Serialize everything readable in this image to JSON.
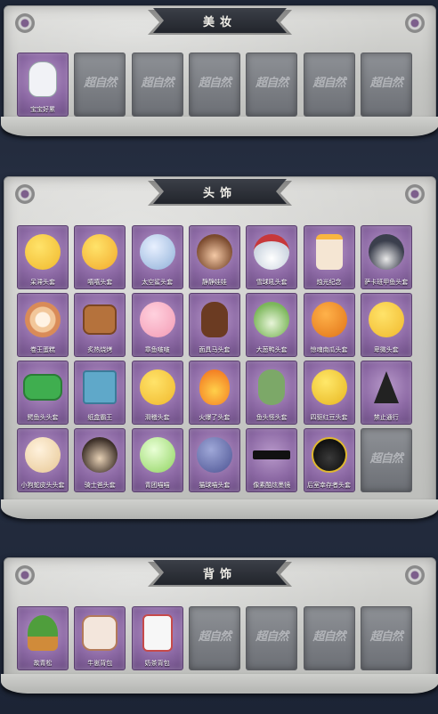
{
  "empty_slot_text": "超自然",
  "sections": [
    {
      "title": "美妆",
      "items": [
        {
          "name": "宝宝好累",
          "icon": "tired-baby-icon",
          "filled": true
        },
        {
          "filled": false
        },
        {
          "filled": false
        },
        {
          "filled": false
        },
        {
          "filled": false
        },
        {
          "filled": false
        },
        {
          "filled": false
        }
      ]
    },
    {
      "title": "头饰",
      "items": [
        {
          "name": "呆滞头套",
          "icon": "dazed-emoji-head-icon",
          "filled": true
        },
        {
          "name": "嘻嘻头套",
          "icon": "grinning-emoji-head-icon",
          "filled": true
        },
        {
          "name": "太空鲨头套",
          "icon": "space-shark-head-icon",
          "filled": true
        },
        {
          "name": "静静娃娃",
          "icon": "doll-head-icon",
          "filled": true
        },
        {
          "name": "雪球吼头套",
          "icon": "snowman-head-icon",
          "filled": true
        },
        {
          "name": "烛光纪念",
          "icon": "candle-head-icon",
          "filled": true
        },
        {
          "name": "萨卡班甲鱼头套",
          "icon": "fish-head-icon",
          "filled": true
        },
        {
          "name": "卷王蛋糕",
          "icon": "cake-roll-head-icon",
          "filled": true
        },
        {
          "name": "炙热烧烤",
          "icon": "bbq-head-icon",
          "filled": true
        },
        {
          "name": "章鱼啵啵",
          "icon": "octopus-head-icon",
          "filled": true
        },
        {
          "name": "面具马头套",
          "icon": "horse-head-icon",
          "filled": true
        },
        {
          "name": "大葱鸭头套",
          "icon": "scallion-duck-head-icon",
          "filled": true
        },
        {
          "name": "惊魂南瓜头套",
          "icon": "pumpkin-head-icon",
          "filled": true
        },
        {
          "name": "卑微头套",
          "icon": "humble-emoji-head-icon",
          "filled": true
        },
        {
          "name": "鳄鱼头头套",
          "icon": "crocodile-head-icon",
          "filled": true
        },
        {
          "name": "纸盒霸王",
          "icon": "box-monster-head-icon",
          "filled": true
        },
        {
          "name": "滑稽头套",
          "icon": "funny-emoji-head-icon",
          "filled": true
        },
        {
          "name": "火爆了头套",
          "icon": "fire-head-icon",
          "filled": true
        },
        {
          "name": "鱼头怪头套",
          "icon": "fish-monster-head-icon",
          "filled": true
        },
        {
          "name": "四驱红豆头套",
          "icon": "yellow-mouse-head-icon",
          "filled": true
        },
        {
          "name": "禁止通行",
          "icon": "traffic-cone-head-icon",
          "filled": true
        },
        {
          "name": "小狗蛇皮头头套",
          "icon": "puppy-head-icon",
          "filled": true
        },
        {
          "name": "骑士爸头套",
          "icon": "dog-glasses-head-icon",
          "filled": true
        },
        {
          "name": "青团喵喵",
          "icon": "green-bun-head-icon",
          "filled": true
        },
        {
          "name": "猫球喵头套",
          "icon": "cat-head-icon",
          "filled": true
        },
        {
          "name": "像素酷炫墨镜",
          "icon": "pixel-sunglasses-icon",
          "filled": true
        },
        {
          "name": "后室幸存者头套",
          "icon": "gas-mask-head-icon",
          "filled": true
        },
        {
          "filled": false
        }
      ]
    },
    {
      "title": "背饰",
      "items": [
        {
          "name": "故青松",
          "icon": "potted-pine-back-icon",
          "filled": true
        },
        {
          "name": "牛崽背包",
          "icon": "cow-backpack-icon",
          "filled": true
        },
        {
          "name": "奶茶背包",
          "icon": "milk-tea-backpack-icon",
          "filled": true
        },
        {
          "filled": false
        },
        {
          "filled": false
        },
        {
          "filled": false
        },
        {
          "filled": false
        }
      ]
    }
  ]
}
